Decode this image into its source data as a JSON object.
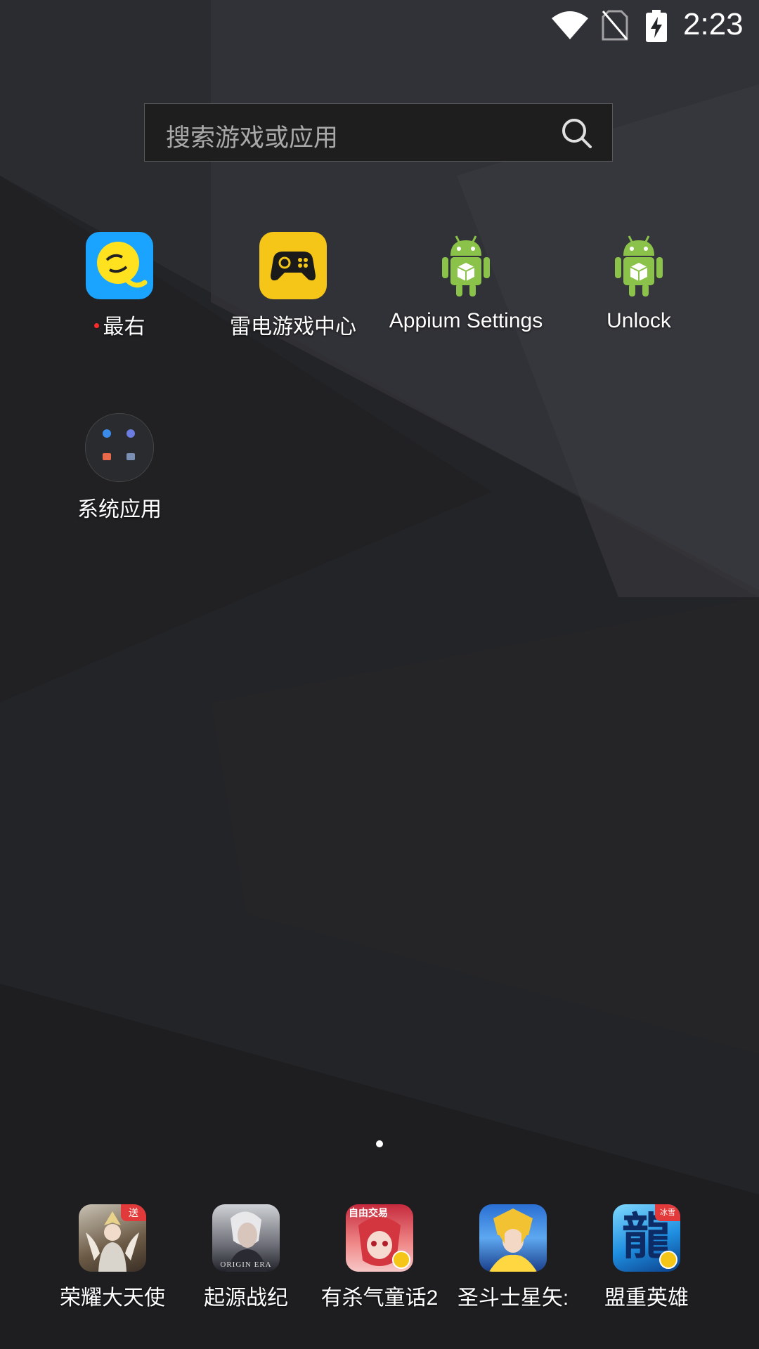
{
  "status_bar": {
    "time": "2:23",
    "icons": [
      "wifi-icon",
      "no-sim-icon",
      "battery-charging-icon"
    ]
  },
  "search": {
    "placeholder": "搜索游戏或应用",
    "icon": "search-icon"
  },
  "apps": [
    {
      "label": "最右",
      "icon": "zuiyou-icon",
      "has_notification_dot": true
    },
    {
      "label": "雷电游戏中心",
      "icon": "gamepad-icon"
    },
    {
      "label": "Appium Settings",
      "icon": "android-icon"
    },
    {
      "label": "Unlock",
      "icon": "android-icon"
    },
    {
      "label": "系统应用",
      "icon": "folder-icon"
    }
  ],
  "page_indicator": {
    "pages": 1,
    "current": 1
  },
  "dock": [
    {
      "label": "荣耀大天使",
      "icon": "game-angel-icon",
      "badge": "送"
    },
    {
      "label": "起源战纪",
      "icon": "game-origin-era-icon",
      "icon_text": "ORIGIN ERA"
    },
    {
      "label": "有杀气童话2",
      "icon": "game-fairytale-icon",
      "icon_text": "自由交易"
    },
    {
      "label": "圣斗士星矢:",
      "icon": "game-saint-seiya-icon"
    },
    {
      "label": "盟重英雄",
      "icon": "game-dragon-icon",
      "icon_text": "龍",
      "badge": "冰雪"
    }
  ],
  "colors": {
    "accent_yellow": "#f5c518",
    "zuiyou_blue": "#1aa3ff",
    "android_green": "#8bc34a"
  }
}
